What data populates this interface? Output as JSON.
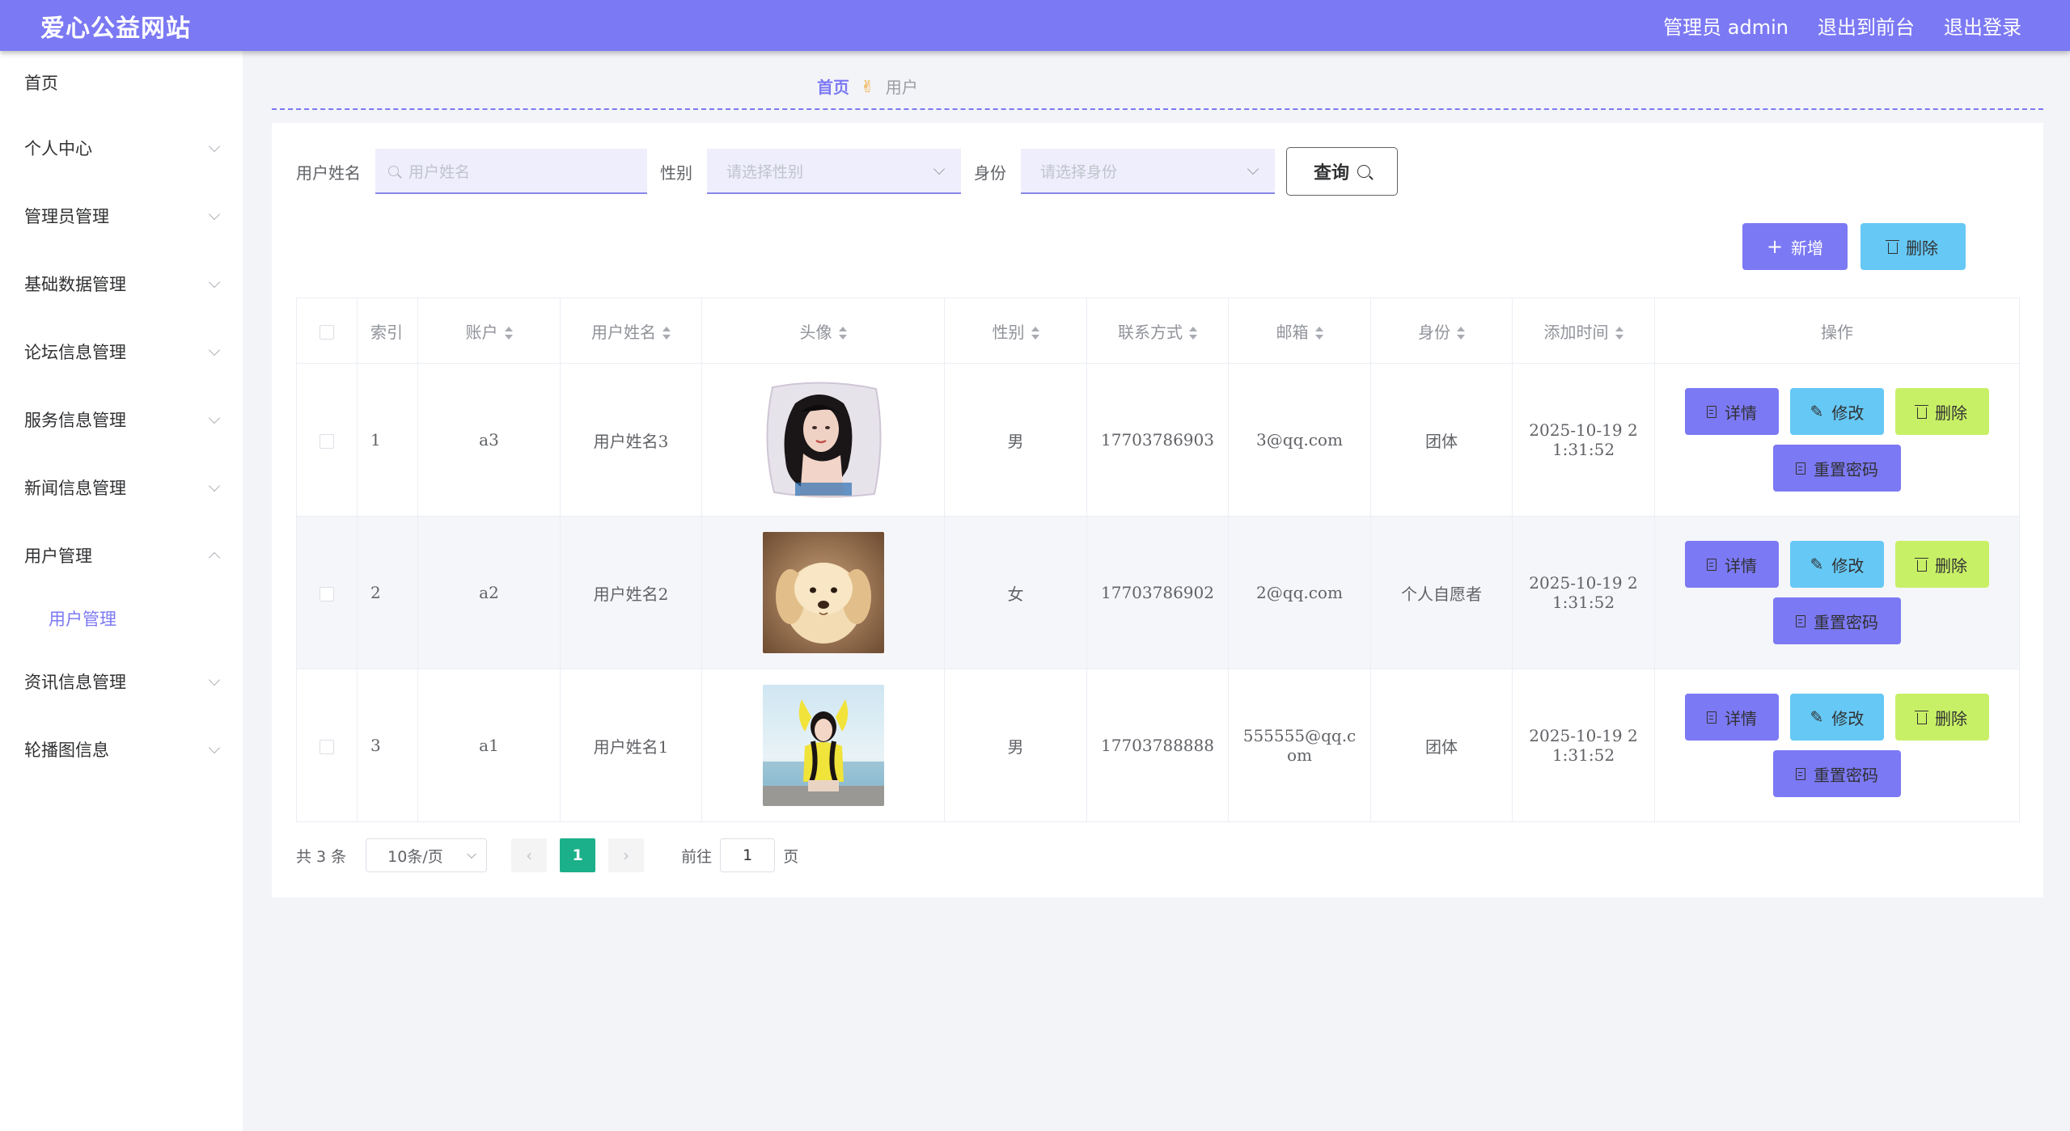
{
  "header": {
    "brand": "爱心公益网站",
    "admin_label": "管理员 admin",
    "front_link": "退出到前台",
    "logout_link": "退出登录"
  },
  "sidebar": {
    "items": [
      {
        "label": "首页",
        "chevron": "none"
      },
      {
        "label": "个人中心",
        "chevron": "down"
      },
      {
        "label": "管理员管理",
        "chevron": "down"
      },
      {
        "label": "基础数据管理",
        "chevron": "down"
      },
      {
        "label": "论坛信息管理",
        "chevron": "down"
      },
      {
        "label": "服务信息管理",
        "chevron": "down"
      },
      {
        "label": "新闻信息管理",
        "chevron": "down"
      },
      {
        "label": "用户管理",
        "chevron": "up"
      },
      {
        "label": "资讯信息管理",
        "chevron": "down"
      },
      {
        "label": "轮播图信息",
        "chevron": "down"
      }
    ],
    "subitem": "用户管理"
  },
  "breadcrumb": {
    "home": "首页",
    "separator": "✌",
    "current": "用户"
  },
  "search": {
    "name_label": "用户姓名",
    "name_placeholder": "用户姓名",
    "gender_label": "性别",
    "gender_placeholder": "请选择性别",
    "identity_label": "身份",
    "identity_placeholder": "请选择身份",
    "query_button": "查询"
  },
  "actions": {
    "add": "新增",
    "delete": "删除"
  },
  "table": {
    "columns": [
      "索引",
      "账户",
      "用户姓名",
      "头像",
      "性别",
      "联系方式",
      "邮箱",
      "身份",
      "添加时间",
      "操作"
    ],
    "rows": [
      {
        "index": "1",
        "account": "a3",
        "name": "用户姓名3",
        "avatar": "portrait-woman-pillow",
        "gender": "男",
        "phone": "17703786903",
        "email": "3@qq.com",
        "identity": "团体",
        "time_line1": "2025-10-19 2",
        "time_line2": "1:31:52"
      },
      {
        "index": "2",
        "account": "a2",
        "name": "用户姓名2",
        "avatar": "puppy-photo",
        "gender": "女",
        "phone": "17703786902",
        "email": "2@qq.com",
        "identity": "个人自愿者",
        "time_line1": "2025-10-19 2",
        "time_line2": "1:31:52"
      },
      {
        "index": "3",
        "account": "a1",
        "name": "用户姓名1",
        "avatar": "girl-yellow-beach",
        "gender": "男",
        "phone": "17703788888",
        "email_line1": "555555@qq.c",
        "email_line2": "om",
        "identity": "团体",
        "time_line1": "2025-10-19 2",
        "time_line2": "1:31:52"
      }
    ],
    "row_buttons": {
      "detail": "详情",
      "edit": "修改",
      "delete": "删除",
      "reset": "重置密码"
    }
  },
  "pagination": {
    "total": "共 3 条",
    "page_size": "10条/页",
    "prev": "‹",
    "current_page": "1",
    "next": "›",
    "goto_label": "前往",
    "goto_value": "1",
    "page_suffix": "页"
  },
  "colors": {
    "primary": "#7c79f4",
    "info": "#66c8f4",
    "lime": "#c8f066",
    "page_active": "#1bb089"
  }
}
